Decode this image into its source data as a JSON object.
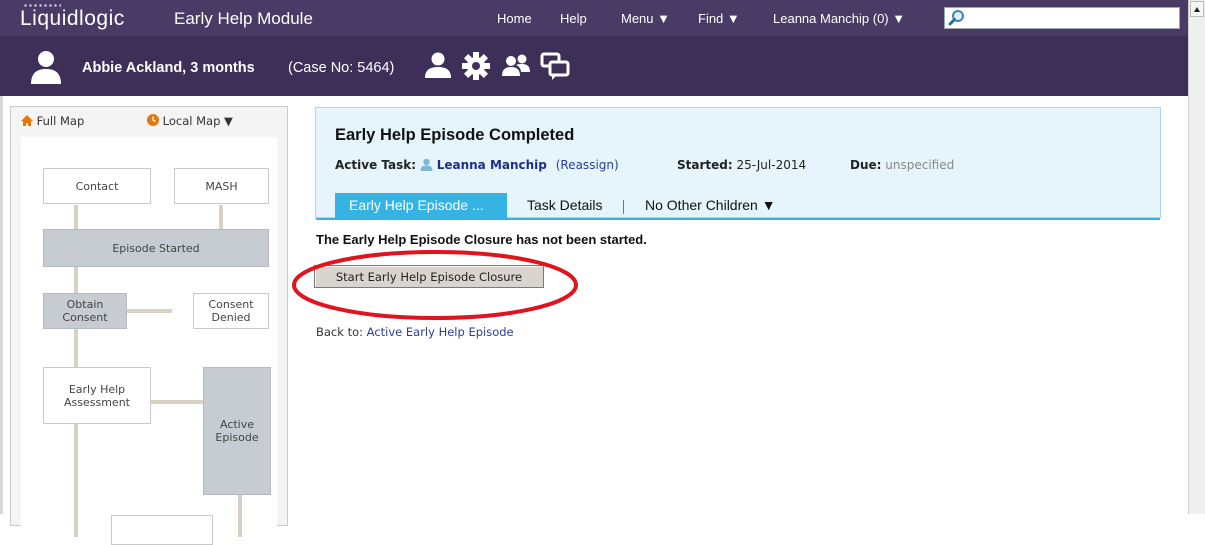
{
  "app": {
    "brand": "Liquidlogic",
    "module": "Early Help Module"
  },
  "nav": {
    "home": "Home",
    "help": "Help",
    "menu": "Menu ▼",
    "find": "Find ▼",
    "user": "Leanna Manchip (0) ▼"
  },
  "search": {
    "value": "",
    "icon": "magnifier-icon"
  },
  "patient": {
    "name": "Abbie Ackland, 3 months",
    "case": "(Case No: 5464)",
    "icons": [
      "person-icon",
      "gear-icon",
      "group-icon",
      "messages-icon"
    ]
  },
  "map": {
    "full_map": "Full Map",
    "local_map": "Local Map ▼",
    "nodes": {
      "contact": "Contact",
      "mash": "MASH",
      "episode_started": "Episode Started",
      "obtain_consent": "Obtain Consent",
      "consent_denied_1": "Consent",
      "consent_denied_2": "Denied",
      "assessment_1": "Early Help",
      "assessment_2": "Assessment",
      "active_1": "Active",
      "active_2": "Episode"
    }
  },
  "task": {
    "title": "Early Help Episode Completed",
    "active_task_label": "Active Task:",
    "assignee": "Leanna Manchip",
    "reassign": "(Reassign)",
    "started_label": "Started:",
    "started_value": "25-Jul-2014",
    "due_label": "Due:",
    "due_value": "unspecified",
    "tabs": [
      "Early Help Episode ...",
      "Task Details",
      "No Other Children ▼"
    ]
  },
  "content": {
    "notice": "The Early Help Episode Closure has not been started.",
    "start_button": "Start Early Help Episode Closure",
    "back_label": "Back to:",
    "back_link": "Active Early Help Episode"
  },
  "colors": {
    "header": "#4a3a66",
    "patient_bar": "#3d2f57",
    "tab_accent": "#35b3e3",
    "highlight": "#e0141e"
  }
}
